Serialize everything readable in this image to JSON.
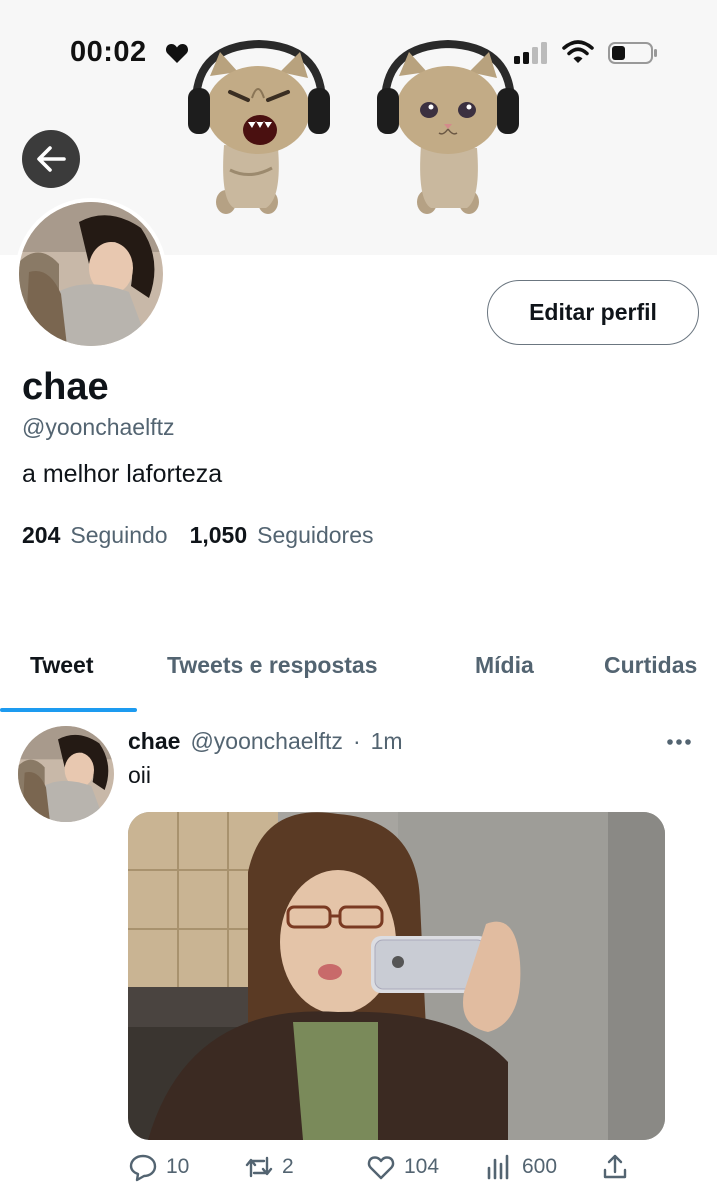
{
  "status_bar": {
    "time": "00:02"
  },
  "profile": {
    "name": "chae",
    "handle": "@yoonchaelftz",
    "bio": "a melhor laforteza",
    "following_count": "204",
    "following_label": "Seguindo",
    "followers_count": "1,050",
    "followers_label": "Seguidores",
    "edit_button": "Editar perfil"
  },
  "tabs": [
    {
      "label": "Tweet",
      "active": true
    },
    {
      "label": "Tweets e respostas",
      "active": false
    },
    {
      "label": "Mídia",
      "active": false
    },
    {
      "label": "Curtidas",
      "active": false
    }
  ],
  "tweet": {
    "name": "chae",
    "handle": "@yoonchaelftz",
    "separator": "·",
    "time": "1m",
    "text": "oii",
    "replies": "10",
    "retweets": "2",
    "likes": "104",
    "views": "600"
  },
  "colors": {
    "accent": "#1d9bf0",
    "secondary_text": "#536471",
    "back_button": "#3b3b3b"
  },
  "icons": [
    "heart-icon",
    "signal-icon",
    "wifi-icon",
    "battery-icon",
    "back-arrow-icon",
    "more-icon",
    "reply-icon",
    "retweet-icon",
    "like-icon",
    "views-icon",
    "share-icon"
  ]
}
